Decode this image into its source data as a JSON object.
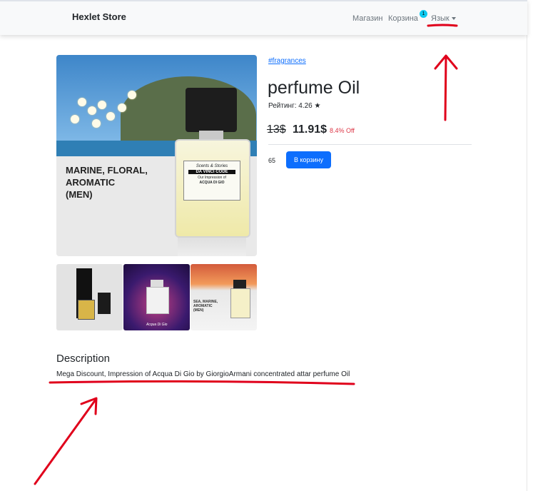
{
  "navbar": {
    "brand": "Hexlet Store",
    "links": {
      "shop": "Магазин",
      "cart": "Корзина",
      "language": "Язык"
    },
    "cart_badge": "1"
  },
  "gallery": {
    "main_tagline_lines": [
      "MARINE, FLORAL,",
      "AROMATIC",
      "(MEN)"
    ],
    "bottle_label": {
      "brand": "Scents & Stories",
      "name": "DA VINCI CODE",
      "line": "Our Impression of",
      "source": "ACQUA DI GIO"
    },
    "thumbnails": [
      {
        "caption": ""
      },
      {
        "caption": "Acqua Di Gio"
      },
      {
        "caption_lines": [
          "SEA, MARINE,",
          "AROMATIC",
          "(MEN)"
        ]
      }
    ]
  },
  "product": {
    "tag": "#fragrances",
    "title": "perfume Oil",
    "rating": "Рейтинг: 4.26 ★",
    "old_price": "13$",
    "new_price": "11.91$",
    "discount": "8.4% Off",
    "stock": "65",
    "add_to_cart_label": "В корзину"
  },
  "description": {
    "title": "Description",
    "text": "Mega Discount, Impression of Acqua Di Gio by GiorgioArmani concentrated attar perfume Oil"
  },
  "colors": {
    "accent": "#0d6efd",
    "discount": "#dc3545",
    "badge": "#0dcaf0",
    "annotation": "#e0001b"
  }
}
